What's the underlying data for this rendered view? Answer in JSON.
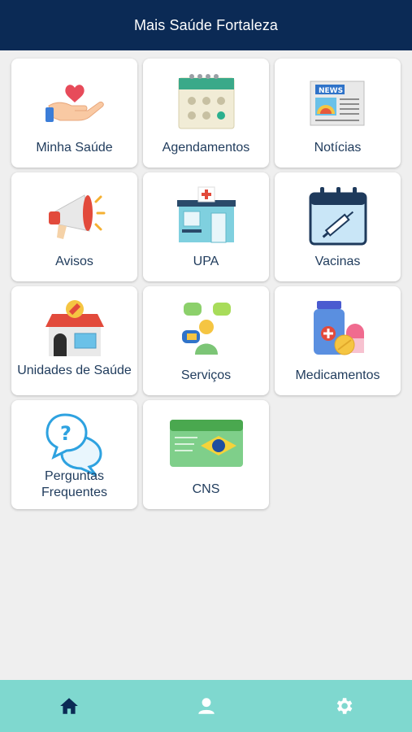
{
  "header": {
    "title": "Mais Saúde Fortaleza"
  },
  "menu": {
    "items": [
      {
        "label": "Minha Saúde",
        "icon": "hand-heart-icon"
      },
      {
        "label": "Agendamentos",
        "icon": "calendar-icon"
      },
      {
        "label": "Notícias",
        "icon": "newspaper-icon"
      },
      {
        "label": "Avisos",
        "icon": "megaphone-icon"
      },
      {
        "label": "UPA",
        "icon": "clinic-building-icon"
      },
      {
        "label": "Vacinas",
        "icon": "vaccine-calendar-icon"
      },
      {
        "label": "Unidades de Saúde",
        "icon": "health-unit-icon"
      },
      {
        "label": "Serviços",
        "icon": "services-person-icon"
      },
      {
        "label": "Medicamentos",
        "icon": "medicine-icon"
      },
      {
        "label_line1": "Perguntas",
        "label_line2": "Frequentes",
        "icon": "question-bubbles-icon"
      },
      {
        "label": "CNS",
        "icon": "sus-card-icon"
      }
    ]
  },
  "bottom_nav": {
    "items": [
      {
        "icon": "home-icon",
        "active": true,
        "color": "#0b2a55"
      },
      {
        "icon": "user-icon",
        "active": false,
        "color": "#ffffff"
      },
      {
        "icon": "gear-icon",
        "active": false,
        "color": "#ffffff"
      }
    ]
  },
  "colors": {
    "header": "#0b2a55",
    "bottom_bar": "#7fd8cf",
    "label": "#1f3b5c",
    "background": "#efefef"
  }
}
